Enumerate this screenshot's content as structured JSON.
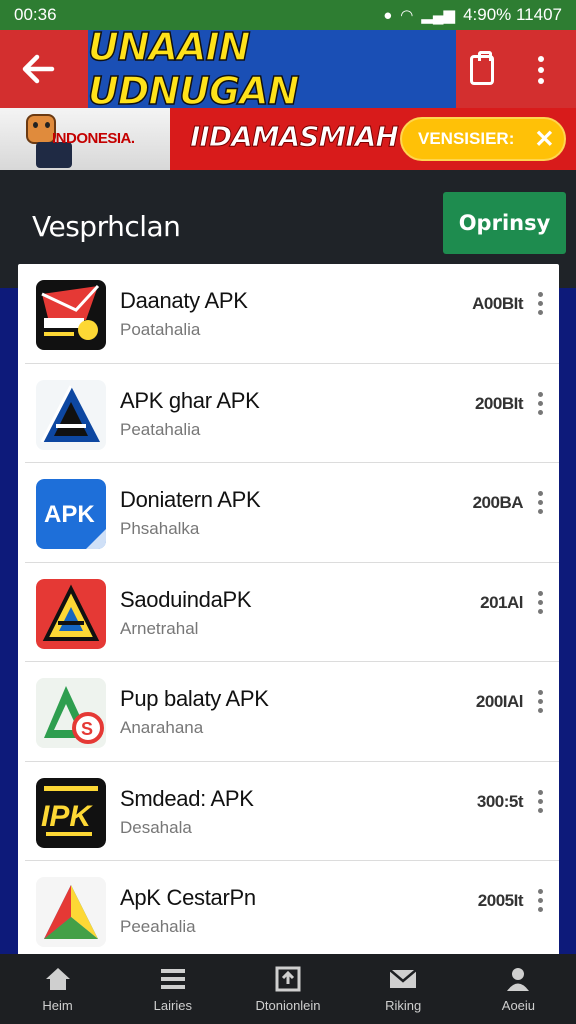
{
  "status_bar": {
    "time": "00:36",
    "right": "4:90% 11407"
  },
  "header": {
    "title": "UNAAIN UDNUGAN"
  },
  "banner": {
    "flag_label": "INDONESIA.",
    "headline": "IIDAMASMIAH",
    "version_button": "VENSISIER:",
    "close_glyph": "✕"
  },
  "section": {
    "title": "Vesprhclan",
    "option_button": "Oprinsy"
  },
  "apps": [
    {
      "name": "Daanaty APK",
      "sub": "Poatahalia",
      "size": "A00BIt",
      "icon": "red-envelope-icon"
    },
    {
      "name": "APK ghar APK",
      "sub": "Peatahalia",
      "size": "200BIt",
      "icon": "a-logo-icon"
    },
    {
      "name": "Doniatern APK",
      "sub": "Phsahalka",
      "size": "200BA",
      "icon": "apk-blue-icon"
    },
    {
      "name": "SaoduindaPK",
      "sub": "Arnetrahal",
      "size": "201Al",
      "icon": "a-red-logo-icon"
    },
    {
      "name": "Pup balaty APK",
      "sub": "Anarahana",
      "size": "200IAl",
      "icon": "green-a-icon"
    },
    {
      "name": "Smdead: APK",
      "sub": "Desahala",
      "size": "300:5t",
      "icon": "ipk-yellow-icon"
    },
    {
      "name": "ApK CestarPn",
      "sub": "Peeahalia",
      "size": "2005It",
      "icon": "triangle-a-icon"
    }
  ],
  "nav": [
    {
      "label": "Heim",
      "icon": "home-icon"
    },
    {
      "label": "Lairies",
      "icon": "list-icon"
    },
    {
      "label": "Dtonionlein",
      "icon": "download-icon"
    },
    {
      "label": "Riking",
      "icon": "mail-icon"
    },
    {
      "label": "Aoeiu",
      "icon": "account-icon"
    }
  ]
}
